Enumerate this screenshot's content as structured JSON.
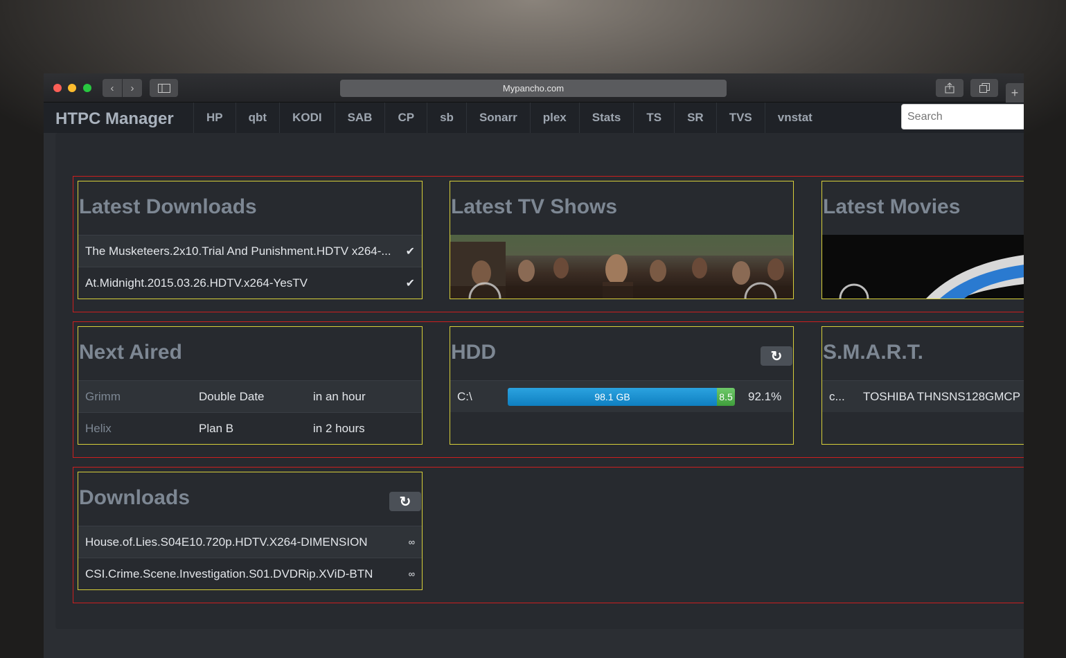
{
  "browser": {
    "url": "Mypancho.com"
  },
  "navbar": {
    "brand": "HTPC Manager",
    "links": [
      "HP",
      "qbt",
      "KODI",
      "SAB",
      "CP",
      "sb",
      "Sonarr",
      "plex",
      "Stats",
      "TS",
      "SR",
      "TVS",
      "vnstat"
    ],
    "search_placeholder": "Search"
  },
  "latest_downloads": {
    "title": "Latest Downloads",
    "items": [
      {
        "name": "The Musketeers.2x10.Trial And Punishment.HDTV x264-...",
        "status_icon": "check-icon"
      },
      {
        "name": "At.Midnight.2015.03.26.HDTV.x264-YesTV",
        "status_icon": "check-icon"
      }
    ]
  },
  "latest_tv_shows": {
    "title": "Latest TV Shows"
  },
  "latest_movies": {
    "title": "Latest Movies"
  },
  "next_aired": {
    "title": "Next Aired",
    "rows": [
      {
        "show": "Grimm",
        "episode": "Double Date",
        "when": "in an hour"
      },
      {
        "show": "Helix",
        "episode": "Plan B",
        "when": "in 2 hours"
      }
    ]
  },
  "hdd": {
    "title": "HDD",
    "drives": [
      {
        "name": "C:\\",
        "used_label": "98.1 GB",
        "free_label": "8.5",
        "percent_label": "92.1%",
        "used_fraction": 0.921
      }
    ]
  },
  "smart": {
    "title": "S.M.A.R.T.",
    "rows": [
      {
        "drive": "c...",
        "model": "TOSHIBA THNSNS128GMCP"
      }
    ]
  },
  "downloads": {
    "title": "Downloads",
    "items": [
      {
        "name": "House.of.Lies.S04E10.720p.HDTV.X264-DIMENSION",
        "icon": "∞"
      },
      {
        "name": "CSI.Crime.Scene.Investigation.S01.DVDRip.XViD-BTN",
        "icon": "∞"
      }
    ]
  },
  "colors": {
    "row_outline": "#cc1f1f",
    "panel_outline": "#d8d03a",
    "hdd_used": "#1a8fd0",
    "hdd_free": "#4fb04a"
  }
}
